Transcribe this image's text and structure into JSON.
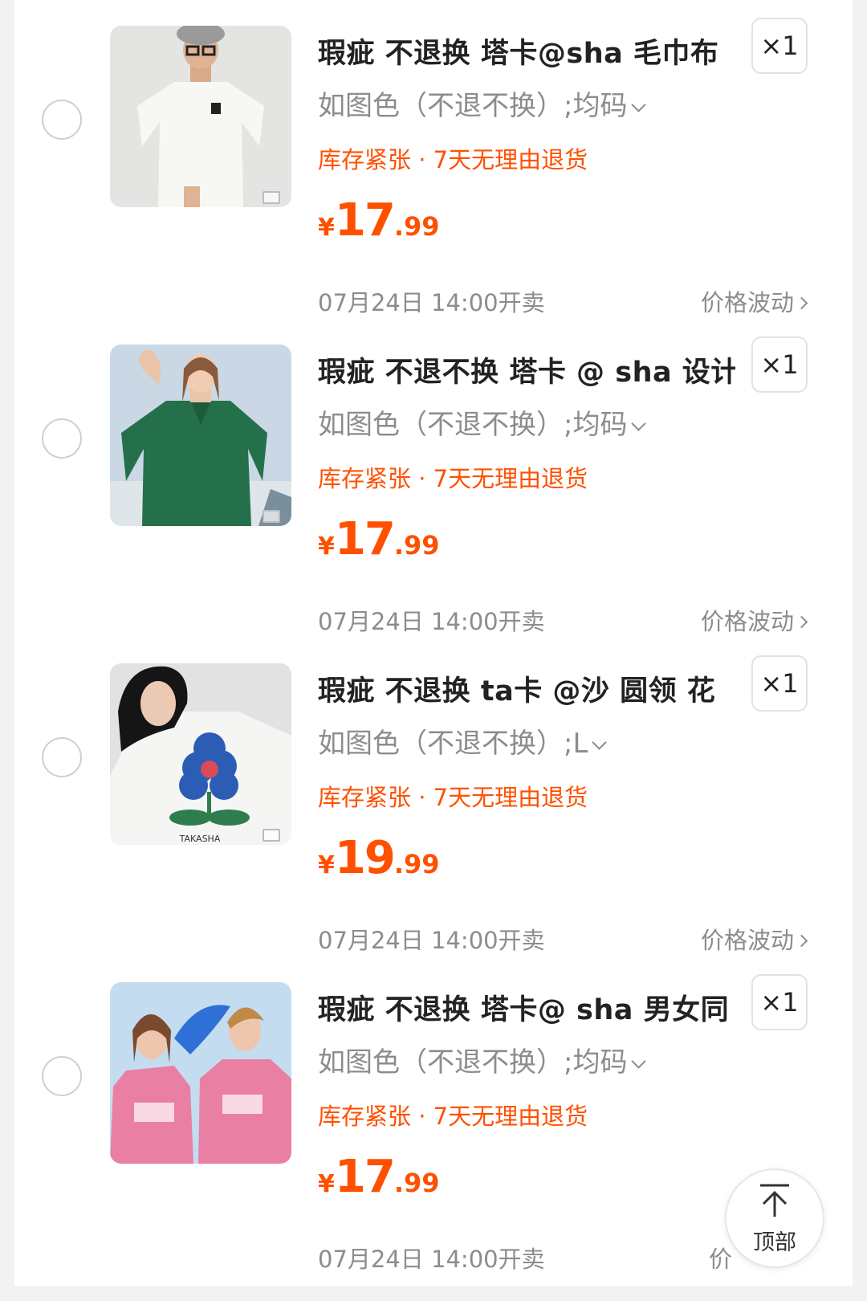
{
  "colors": {
    "accent": "#ff5000",
    "muted": "#8c8c8c",
    "text": "#222222"
  },
  "items": [
    {
      "title": "瑕疵 不退换 塔卡@sha 毛巾布",
      "qty": "×1",
      "sku": "如图色（不退不换）;均码",
      "promo": "库存紧张 · 7天无理由退货",
      "currency": "¥",
      "price_int": "17",
      "price_dec": ".99",
      "sale_time": "07月24日 14:00开卖",
      "price_note": "价格波动",
      "image": "white-tshirt-model-photo"
    },
    {
      "title": "瑕疵 不退不换 塔卡 @ sha  设计",
      "qty": "×1",
      "sku": "如图色（不退不换）;均码",
      "promo": "库存紧张 · 7天无理由退货",
      "currency": "¥",
      "price_int": "17",
      "price_dec": ".99",
      "sale_time": "07月24日 14:00开卖",
      "price_note": "价格波动",
      "image": "green-polo-model-photo"
    },
    {
      "title": "瑕疵 不退换 ta卡 @沙   圆领 花",
      "qty": "×1",
      "sku": "如图色（不退不换）;L",
      "promo": "库存紧张 · 7天无理由退货",
      "currency": "¥",
      "price_int": "19",
      "price_dec": ".99",
      "sale_time": "07月24日 14:00开卖",
      "price_note": "价格波动",
      "image": "white-flower-tshirt-model-photo",
      "image_text": "TAKASHA"
    },
    {
      "title": "瑕疵  不退换 塔卡@ sha 男女同",
      "qty": "×1",
      "sku": "如图色（不退不换）;均码",
      "promo": "库存紧张 · 7天无理由退货",
      "currency": "¥",
      "price_int": "17",
      "price_dec": ".99",
      "sale_time": "07月24日 14:00开卖",
      "price_note": "价",
      "image": "pink-tshirt-couple-photo"
    }
  ],
  "back_to_top": {
    "label": "顶部",
    "icon": "arrow-up-to-top-icon"
  }
}
